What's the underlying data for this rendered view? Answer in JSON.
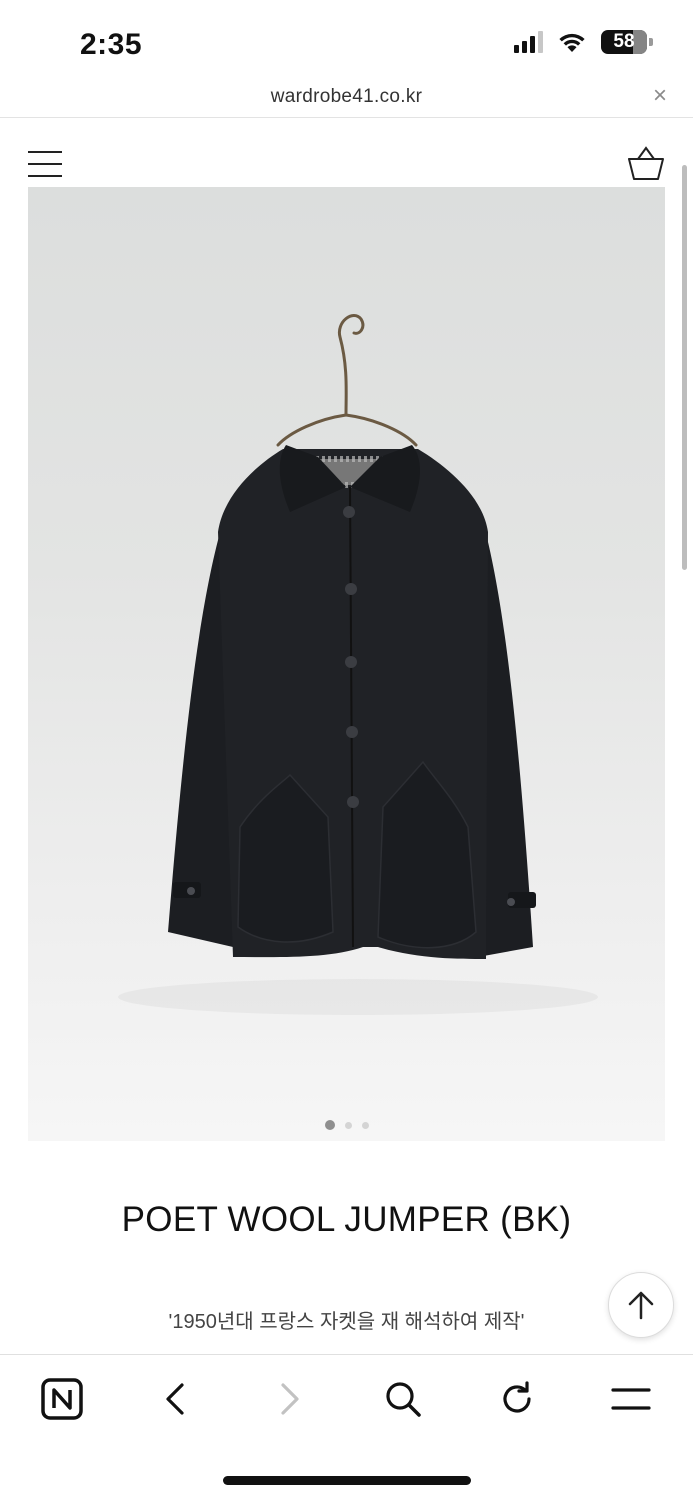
{
  "status_bar": {
    "time": "2:35",
    "battery_level": "58",
    "icons": [
      "signal-icon",
      "wifi-icon",
      "battery-icon"
    ]
  },
  "url_bar": {
    "url": "wardrobe41.co.kr",
    "close_label": "×"
  },
  "site_header": {
    "icons": [
      "menu-icon",
      "shopping-basket-icon"
    ]
  },
  "product": {
    "title": "POET WOOL JUMPER (BK)",
    "description": "'1950년대 프랑스 자켓을 재 해석하여 제작'",
    "image_alt": "black wool jumper on hanger",
    "carousel": {
      "total": 3,
      "active_index": 0
    }
  },
  "toolbar": {
    "icons": [
      "naver-icon",
      "back-icon",
      "forward-icon",
      "search-icon",
      "reload-icon",
      "menu-icon"
    ],
    "forward_disabled": true
  },
  "colors": {
    "text": "#111111",
    "muted": "#8a8a8a",
    "background": "#ffffff"
  }
}
